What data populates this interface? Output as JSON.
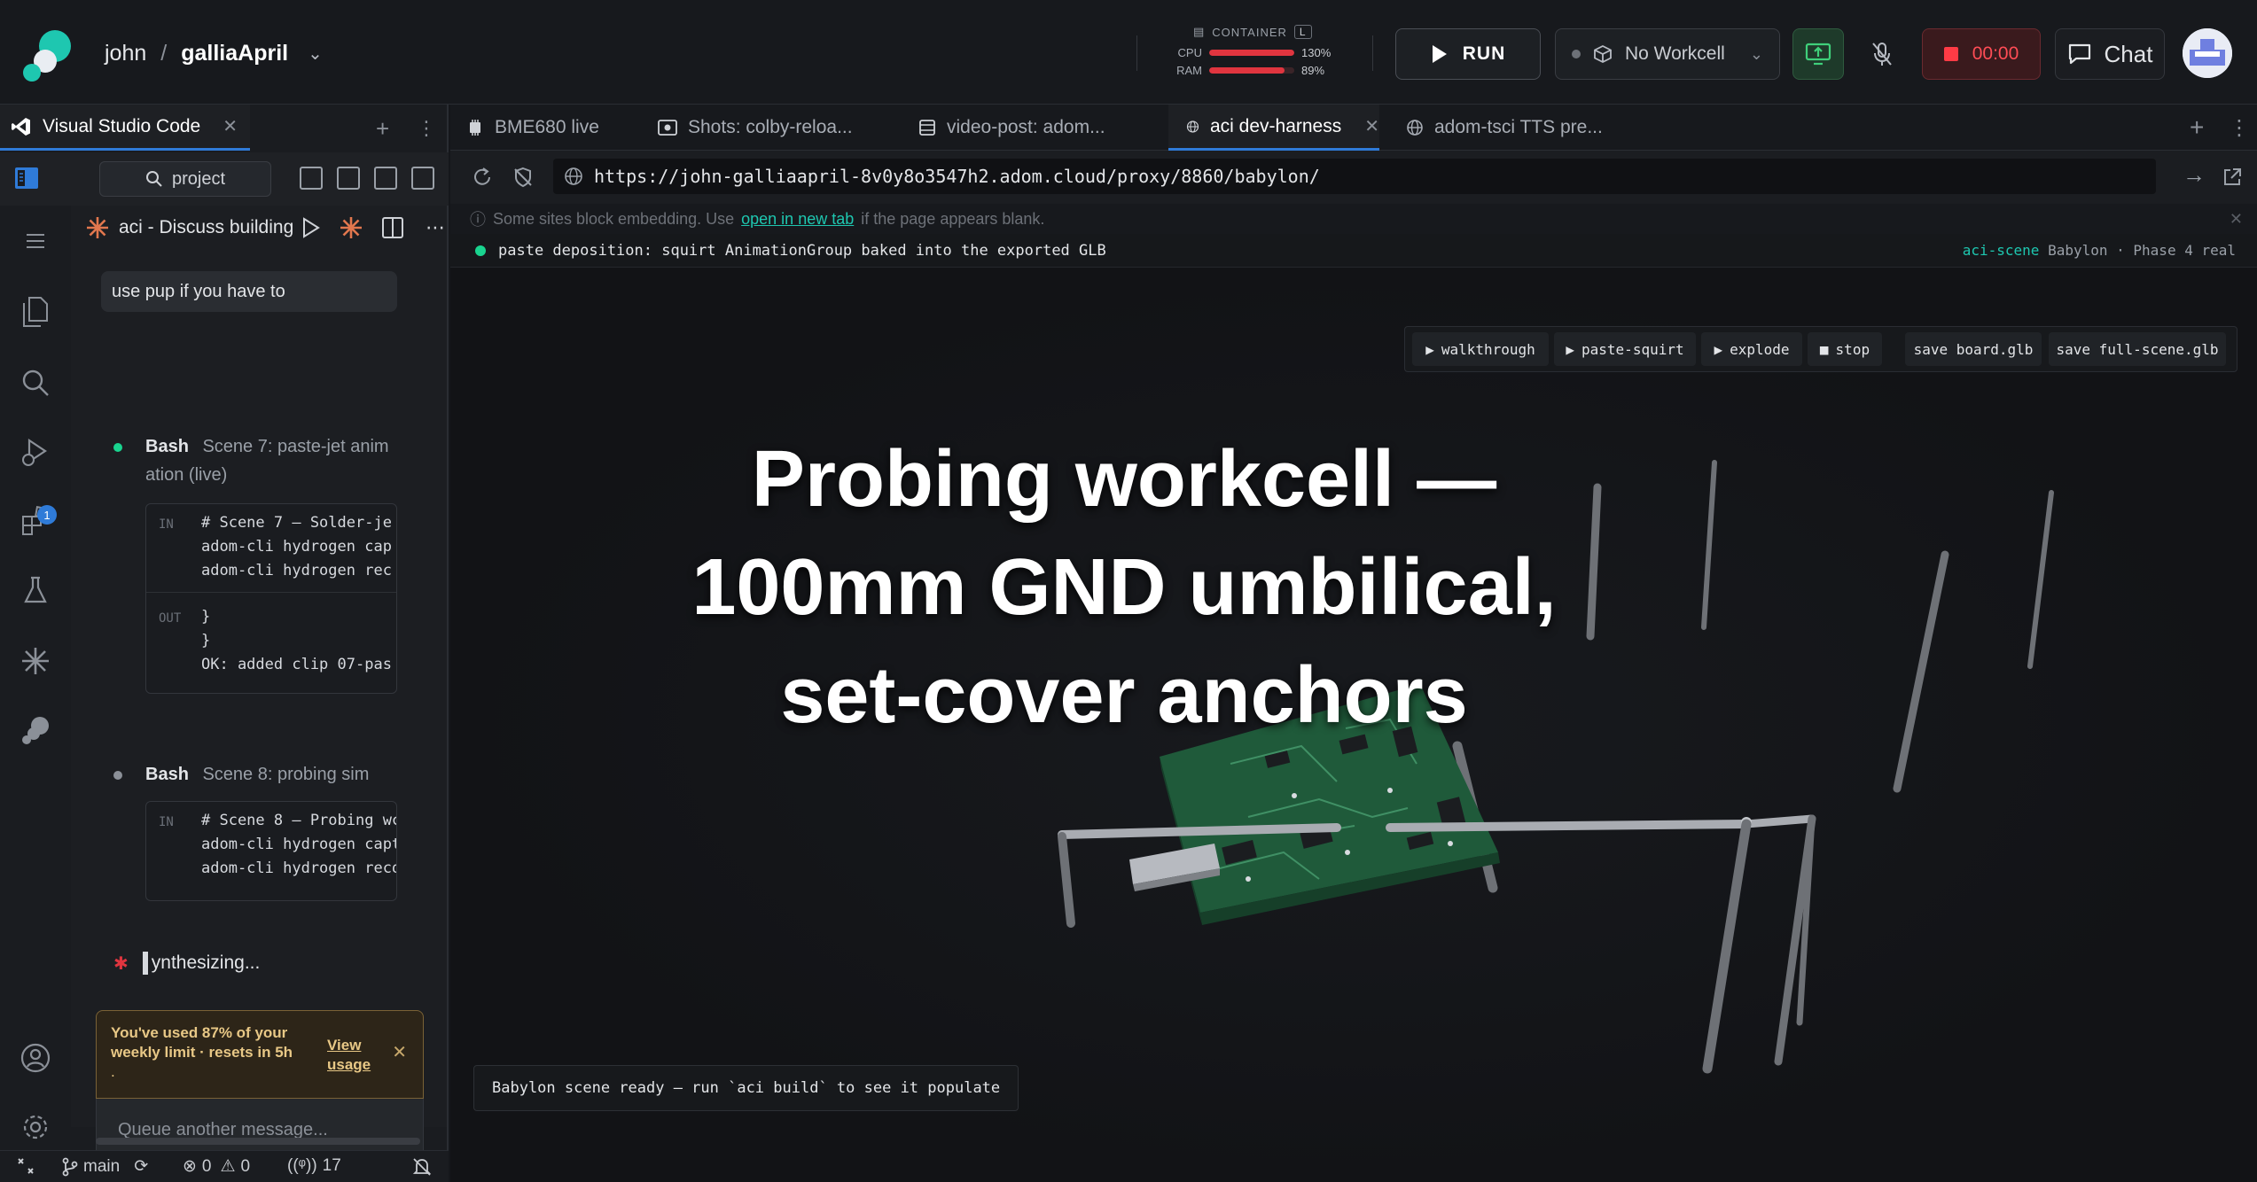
{
  "header": {
    "user": "john",
    "separator": "/",
    "project": "galliaApril",
    "container": {
      "label": "CONTAINER",
      "size_tag": "L",
      "cpu_label": "CPU",
      "cpu_value": "130%",
      "cpu_fraction": 1.0,
      "ram_label": "RAM",
      "ram_value": "89%",
      "ram_fraction": 0.89
    },
    "run_label": "RUN",
    "workcell_label": "No Workcell",
    "timer": "00:00",
    "chat_label": "Chat"
  },
  "left_pane": {
    "tab_label": "Visual Studio Code",
    "search_label": "project",
    "activity_badge": "1",
    "chat": {
      "session_title": "aci - Discuss building",
      "user_message": "use pup if you have to",
      "items": [
        {
          "kind": "Bash",
          "title": "Scene 7: paste-jet anim",
          "title_cont": "ation (live)",
          "in_tag": "IN",
          "in_lines": [
            "# Scene 7 — Solder-je",
            "adom-cli hydrogen cap",
            "adom-cli hydrogen rec"
          ],
          "out_tag": "OUT",
          "out_lines": [
            "}",
            "}",
            "OK: added clip 07-pas"
          ]
        },
        {
          "kind": "Bash",
          "title": "Scene 8: probing sim",
          "in_tag": "IN",
          "in_lines": [
            "# Scene 8 — Probing wc",
            "adom-cli hydrogen capt",
            "adom-cli hydrogen reco"
          ]
        }
      ],
      "synth_text": "ynthesizing...",
      "limit_banner": {
        "message": "You've used 87% of your weekly limit · resets in 5h",
        "trailing": ".",
        "link": "View usage"
      },
      "composer_placeholder": "Queue another message..."
    },
    "status": {
      "branch": "main",
      "errors": "0",
      "warnings": "0",
      "ports": "17"
    }
  },
  "browser": {
    "tabs": [
      {
        "label": "BME680 live",
        "active": false
      },
      {
        "label": "Shots: colby-reloa...",
        "active": false
      },
      {
        "label": "video-post: adom...",
        "active": false
      },
      {
        "label": "aci dev-harness",
        "active": true
      },
      {
        "label": "adom-tsci TTS pre...",
        "active": false
      }
    ],
    "url": "https://john-galliaapril-8v0y8o3547h2.adom.cloud/proxy/8860/babylon/",
    "embed_note": {
      "before": "Some sites block embedding. Use",
      "link": "open in new tab",
      "after": "if the page appears blank."
    },
    "status_line": "paste deposition: squirt AnimationGroup baked into the exported GLB",
    "status_right_accent": "aci-scene",
    "status_right": "Babylon · Phase 4 real",
    "scene_buttons": [
      "walkthrough",
      "paste-squirt",
      "explode",
      "stop",
      "save board.glb",
      "save full-scene.glb"
    ],
    "caption_lines": [
      "Probing workcell —",
      "100mm GND umbilical,",
      "set-cover anchors"
    ],
    "ready_note": "Babylon scene ready — run `aci build` to see it populate"
  },
  "colors": {
    "accent_blue": "#2f7bd8",
    "accent_teal": "#1ec7b0",
    "record_red": "#ff3b45",
    "status_green": "#19d48f",
    "pcb_green": "#1f5a3a"
  }
}
